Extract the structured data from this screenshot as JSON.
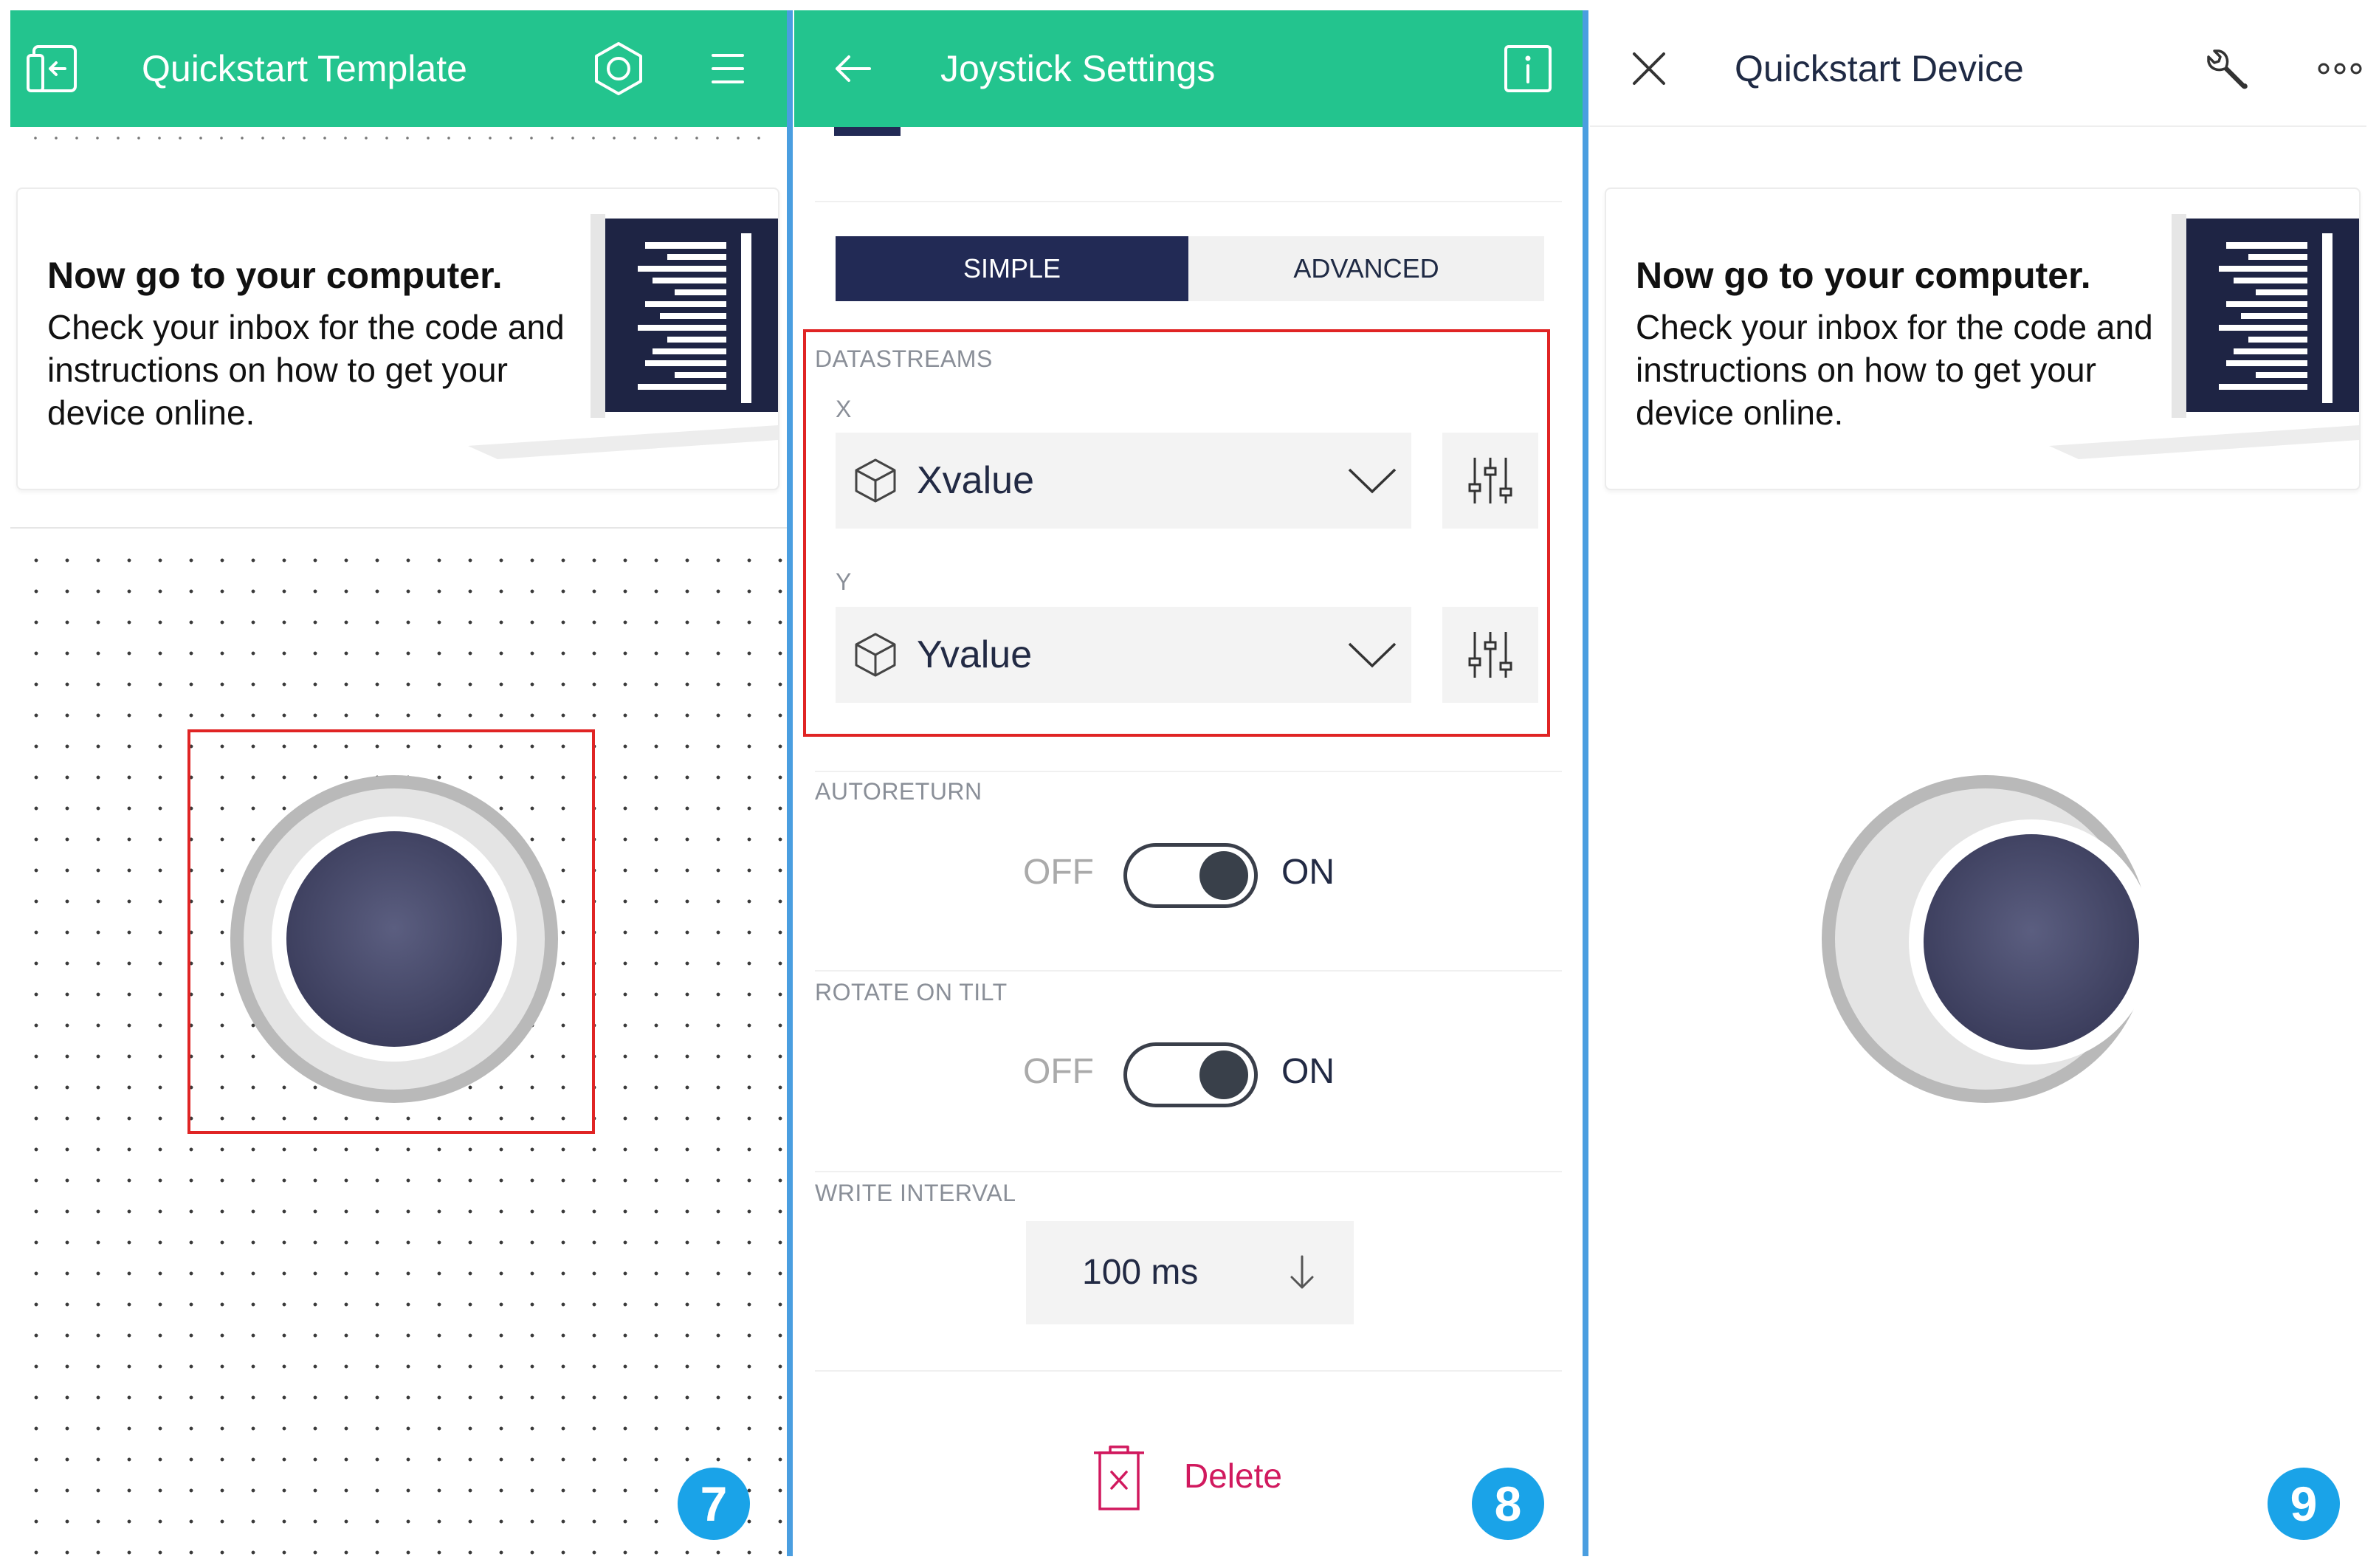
{
  "panel7": {
    "title": "Quickstart Template",
    "card": {
      "title": "Now go to your computer.",
      "body": "Check your inbox for the code and instructions on how to get your device online."
    },
    "step": "7"
  },
  "panel8": {
    "title": "Joystick Settings",
    "mode_tabs": {
      "simple": "SIMPLE",
      "advanced": "ADVANCED",
      "selected": "SIMPLE"
    },
    "datastreams": {
      "label": "DATASTREAMS",
      "x_label": "X",
      "x_value": "Xvalue",
      "y_label": "Y",
      "y_value": "Yvalue"
    },
    "autoreturn": {
      "label": "AUTORETURN",
      "off": "OFF",
      "on": "ON",
      "state": "ON"
    },
    "rotate_on_tilt": {
      "label": "ROTATE ON TILT",
      "off": "OFF",
      "on": "ON",
      "state": "ON"
    },
    "write_interval": {
      "label": "WRITE INTERVAL",
      "value": "100 ms"
    },
    "delete_label": "Delete",
    "step": "8"
  },
  "panel9": {
    "title": "Quickstart Device",
    "card": {
      "title": "Now go to your computer.",
      "body": "Check your inbox for the code and instructions on how to get your device online."
    },
    "step": "9"
  },
  "colors": {
    "header_green": "#23c48e",
    "divider_blue": "#4a9ee0",
    "segment_active": "#222a55",
    "highlight_red": "#e02424",
    "delete_red": "#d1195e",
    "badge_blue": "#1aa3e8",
    "joystick_knob": "#4a4d6e"
  },
  "icons": {
    "panel7_left": "exit-door-icon",
    "panel7_settings": "hexagon-nut-icon",
    "panel7_menu": "hamburger-menu-icon",
    "panel8_back": "back-arrow-icon",
    "panel8_info": "info-icon",
    "panel9_close": "close-icon",
    "panel9_wrench": "wrench-icon",
    "panel9_more": "more-dots-icon"
  }
}
